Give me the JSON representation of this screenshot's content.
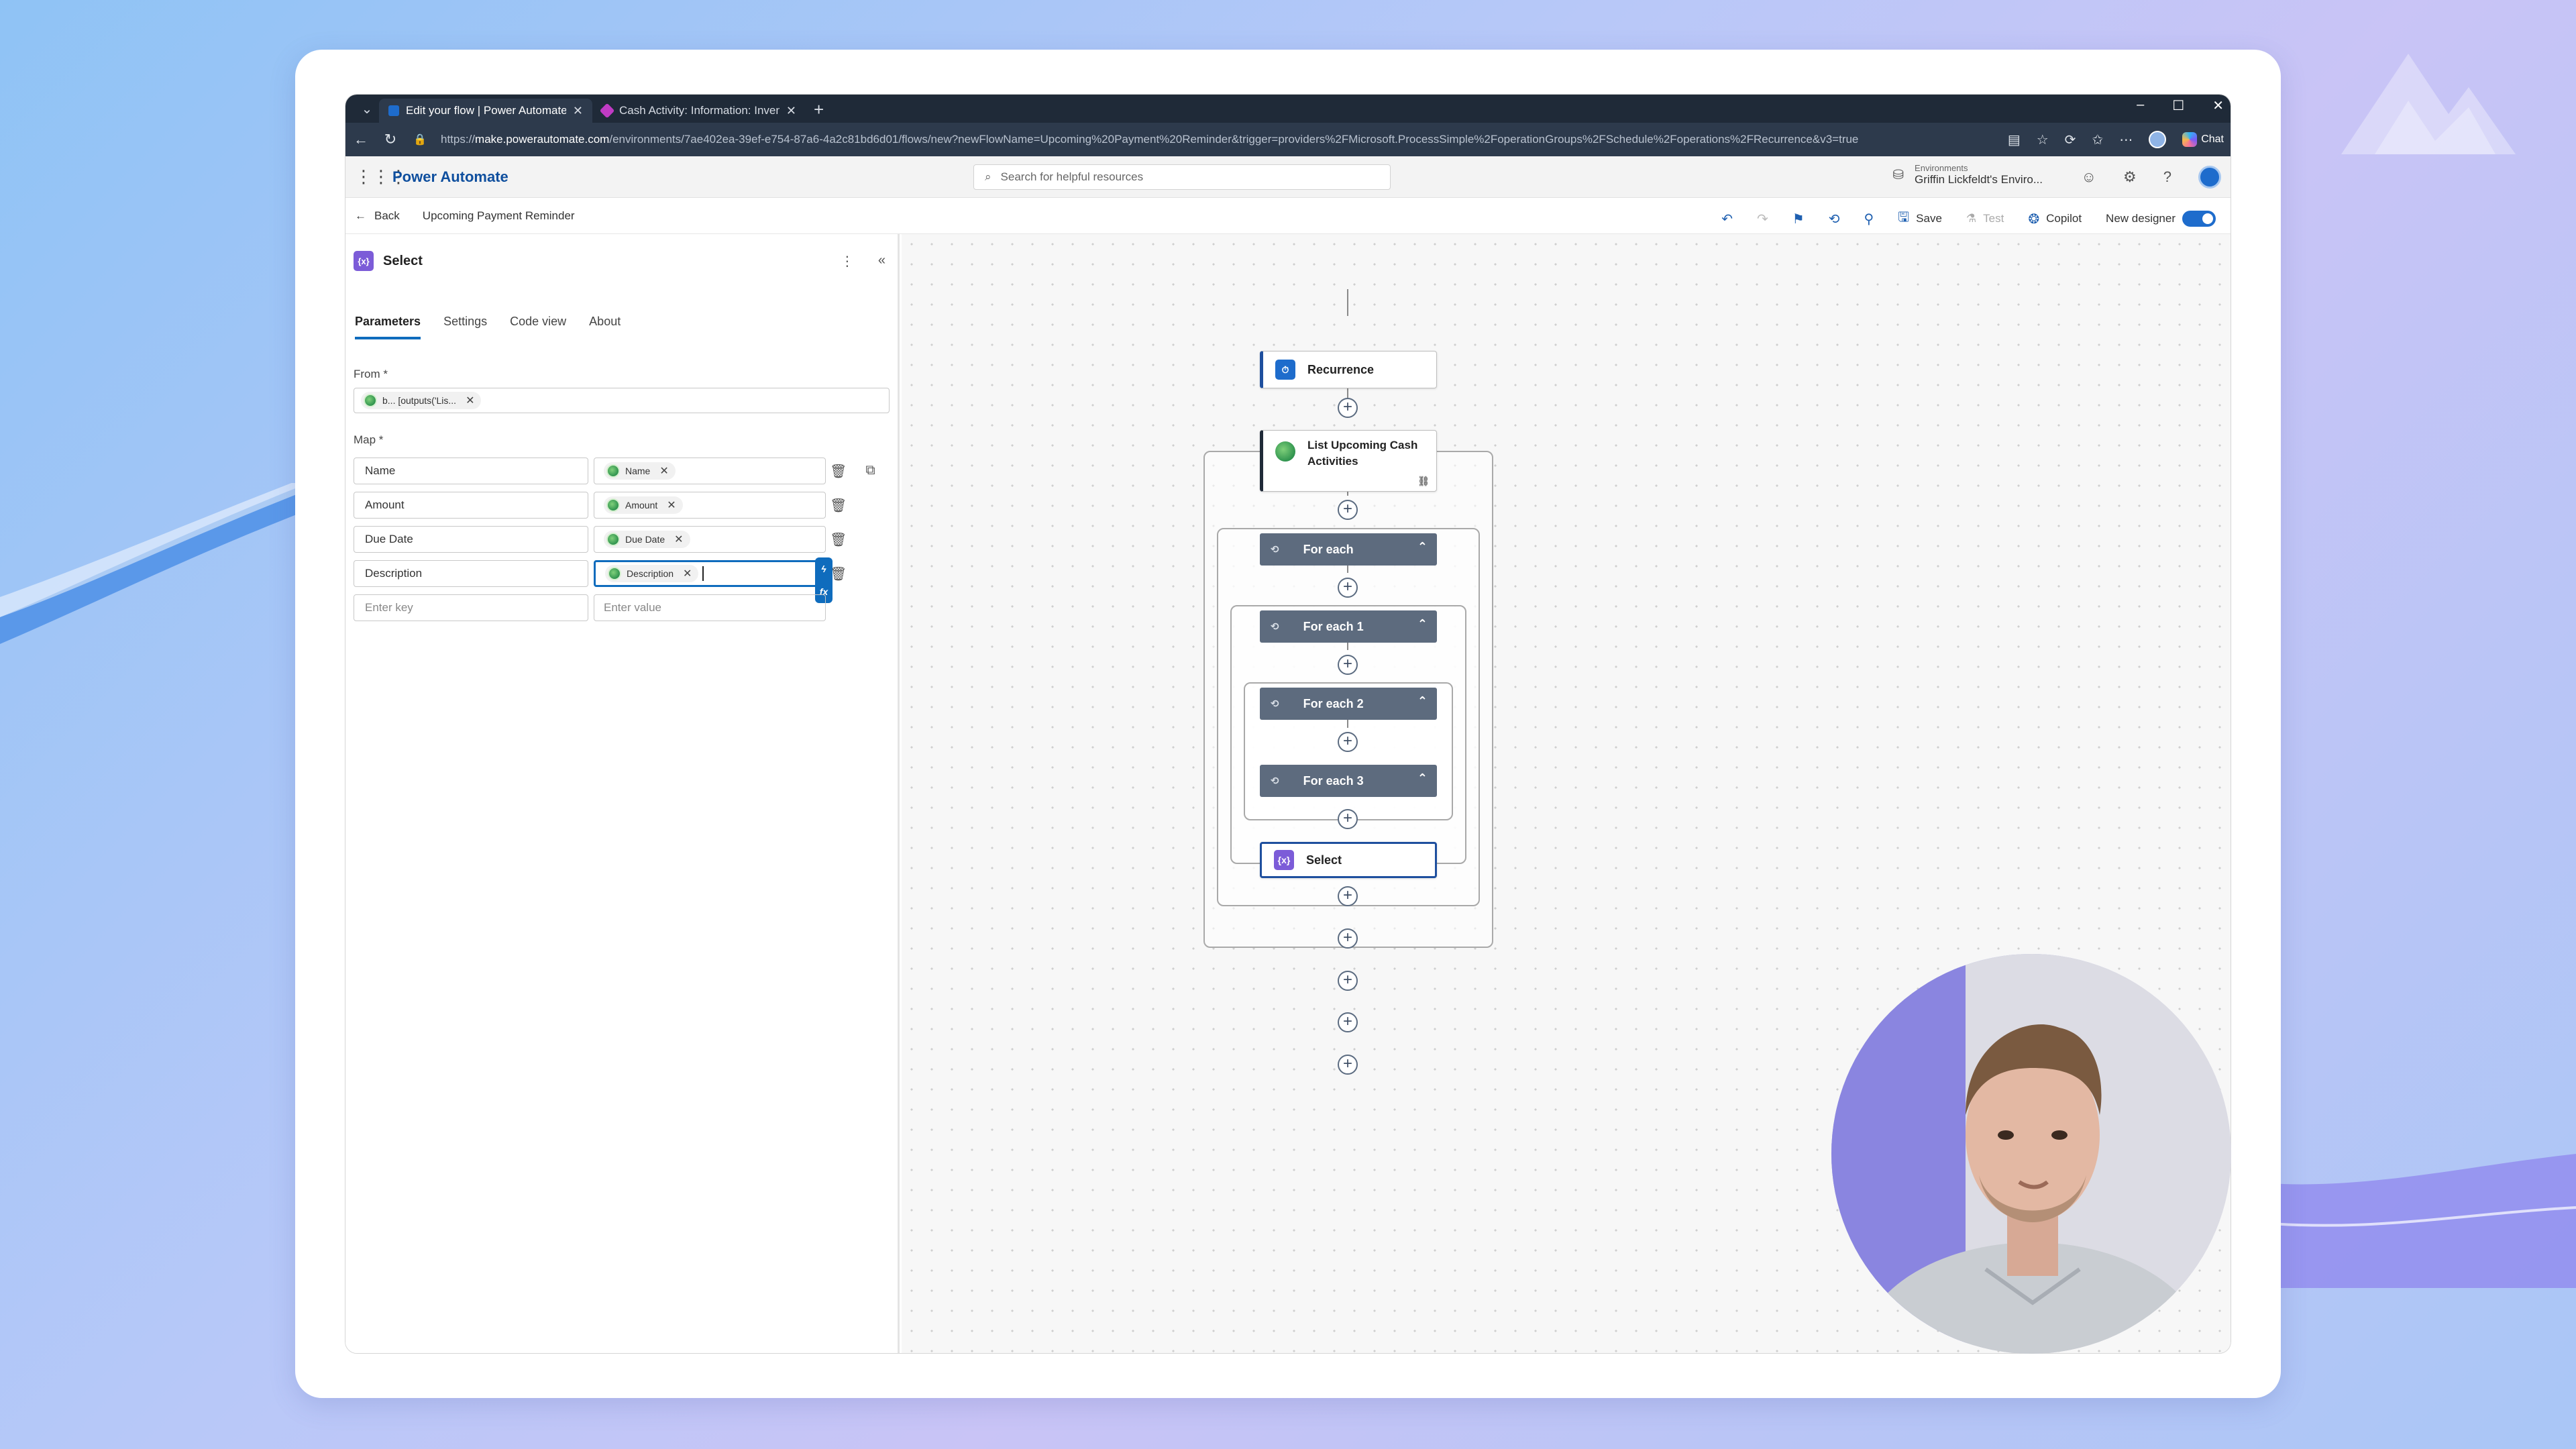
{
  "browser": {
    "tabs": [
      {
        "title": "Edit your flow | Power Automate",
        "active": true
      },
      {
        "title": "Cash Activity: Information: Invent",
        "active": false
      }
    ],
    "url_prefix": "https://",
    "url_host": "make.powerautomate.com",
    "url_path": "/environments/7ae402ea-39ef-e754-87a6-4a2c81bd6d01/flows/new?newFlowName=Upcoming%20Payment%20Reminder&trigger=providers%2FMicrosoft.ProcessSimple%2FoperationGroups%2FSchedule%2Foperations%2FRecurrence&v3=true",
    "chat_label": "Chat"
  },
  "header": {
    "app_name": "Power Automate",
    "search_placeholder": "Search for helpful resources",
    "env_label": "Environments",
    "env_value": "Griffin Lickfeldt's Enviro..."
  },
  "cmdbar": {
    "back_label": "Back",
    "flow_name": "Upcoming Payment Reminder",
    "save_label": "Save",
    "test_label": "Test",
    "copilot_label": "Copilot",
    "new_designer_label": "New designer"
  },
  "panel": {
    "title": "Select",
    "tabs": [
      "Parameters",
      "Settings",
      "Code view",
      "About"
    ],
    "from_label": "From *",
    "from_token": "b... [outputs('Lis...",
    "map_label": "Map *",
    "rows": [
      {
        "key": "Name",
        "token": "Name"
      },
      {
        "key": "Amount",
        "token": "Amount"
      },
      {
        "key": "Due Date",
        "token": "Due Date"
      },
      {
        "key": "Description",
        "token": "Description"
      }
    ],
    "key_placeholder": "Enter key",
    "value_placeholder": "Enter value",
    "fx_label": "fx"
  },
  "canvas": {
    "nodes": {
      "recurrence": "Recurrence",
      "list_line1": "List Upcoming Cash",
      "list_line2": "Activities",
      "for_each": "For each",
      "for_each_1": "For each 1",
      "for_each_2": "For each 2",
      "for_each_3": "For each 3",
      "select": "Select"
    }
  },
  "colors": {
    "accent": "#0f6cbd",
    "loop_header": "#5d6b7e",
    "select_icon": "#7c5cd8",
    "recurrence_icon": "#1e6ccc"
  }
}
